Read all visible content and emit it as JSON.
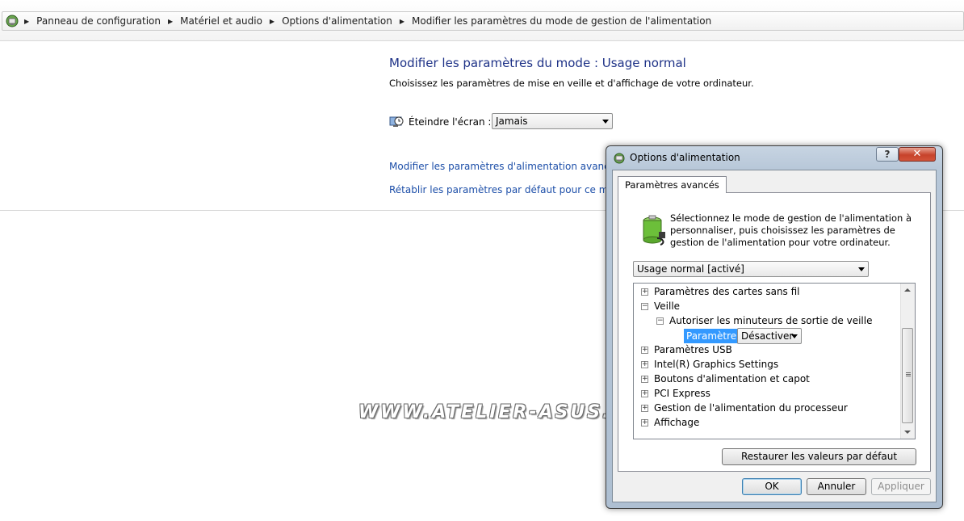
{
  "breadcrumb": {
    "items": [
      "Panneau de configuration",
      "Matériel et audio",
      "Options d'alimentation",
      "Modifier les paramètres du mode de gestion de l'alimentation"
    ]
  },
  "main": {
    "title": "Modifier les paramètres du mode : Usage normal",
    "subtitle": "Choisissez les paramètres de mise en veille et d'affichage de votre ordinateur.",
    "screen_off_label": "Éteindre l'écran :",
    "screen_off_value": "Jamais",
    "link_advanced": "Modifier les paramètres d'alimentation avancés",
    "link_restore": "Rétablir les paramètres par défaut pour ce mode"
  },
  "watermark": "WWW.ATELIER-ASUS.FR",
  "dialog": {
    "title": "Options d'alimentation",
    "help_label": "?",
    "close_label": "✕",
    "tab_label": "Paramètres avancés",
    "description": "Sélectionnez le mode de gestion de l'alimentation à personnaliser, puis choisissez les paramètres de gestion de l'alimentation pour votre ordinateur.",
    "plan_value": "Usage normal [activé]",
    "tree": {
      "items": [
        {
          "label": "Paramètres des cartes sans fil",
          "expander": "+"
        },
        {
          "label": "Veille",
          "expander": "−"
        },
        {
          "label": "Autoriser les minuteurs de sortie de veille",
          "expander": "−"
        },
        {
          "label": "Paramètres USB",
          "expander": "+"
        },
        {
          "label": "Intel(R) Graphics Settings",
          "expander": "+"
        },
        {
          "label": "Boutons d'alimentation et capot",
          "expander": "+"
        },
        {
          "label": "PCI Express",
          "expander": "+"
        },
        {
          "label": "Gestion de l'alimentation du processeur",
          "expander": "+"
        },
        {
          "label": "Affichage",
          "expander": "+"
        }
      ],
      "param_label": "Paramètre :",
      "param_value": "Désactiver"
    },
    "restore_button": "Restaurer les valeurs par défaut",
    "ok_button": "OK",
    "cancel_button": "Annuler",
    "apply_button": "Appliquer"
  }
}
